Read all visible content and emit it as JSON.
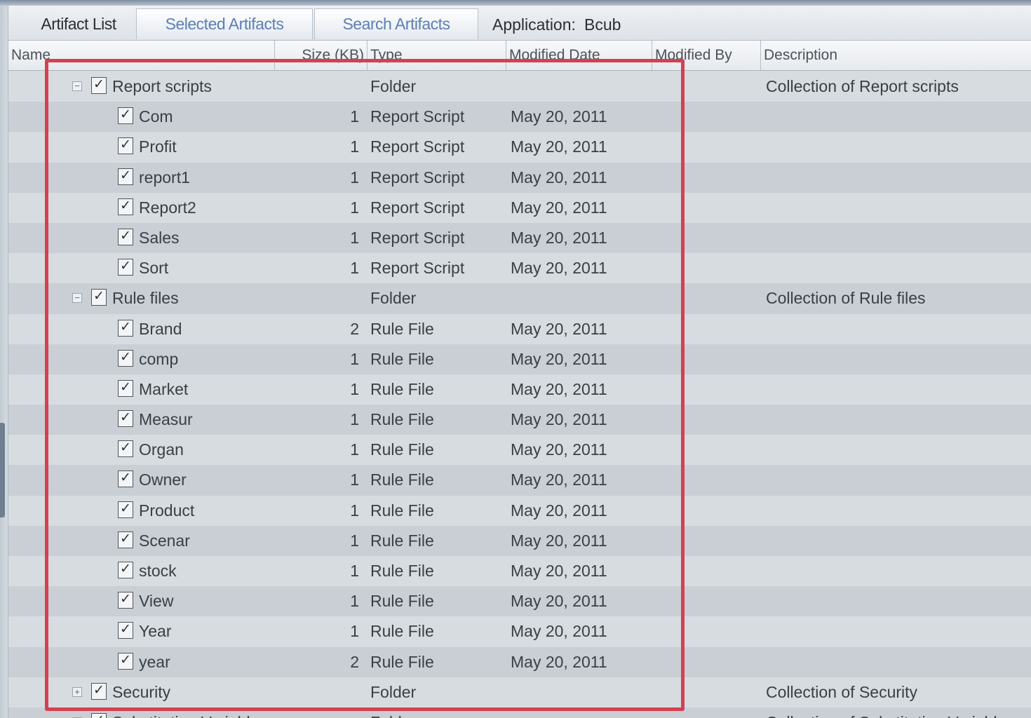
{
  "tabs": {
    "artifact_list": "Artifact List",
    "selected_artifacts": "Selected Artifacts",
    "search_artifacts": "Search Artifacts"
  },
  "application": {
    "label": "Application:",
    "value": "Bcub"
  },
  "columns": {
    "name": "Name",
    "size": "Size (KB)",
    "type": "Type",
    "modified_date": "Modified Date",
    "modified_by": "Modified By",
    "description": "Description"
  },
  "rows": [
    {
      "level": 0,
      "expander": "−",
      "checked": "✓",
      "name": "Report scripts",
      "size": "",
      "type": "Folder",
      "date": "",
      "desc": "Collection of Report scripts"
    },
    {
      "level": 1,
      "checked": "✓",
      "name": "Com",
      "size": "1",
      "type": "Report Script",
      "date": "May 20, 2011",
      "desc": ""
    },
    {
      "level": 1,
      "checked": "✓",
      "name": "Profit",
      "size": "1",
      "type": "Report Script",
      "date": "May 20, 2011",
      "desc": ""
    },
    {
      "level": 1,
      "checked": "✓",
      "name": "report1",
      "size": "1",
      "type": "Report Script",
      "date": "May 20, 2011",
      "desc": ""
    },
    {
      "level": 1,
      "checked": "✓",
      "name": "Report2",
      "size": "1",
      "type": "Report Script",
      "date": "May 20, 2011",
      "desc": ""
    },
    {
      "level": 1,
      "checked": "✓",
      "name": "Sales",
      "size": "1",
      "type": "Report Script",
      "date": "May 20, 2011",
      "desc": ""
    },
    {
      "level": 1,
      "checked": "✓",
      "name": "Sort",
      "size": "1",
      "type": "Report Script",
      "date": "May 20, 2011",
      "desc": ""
    },
    {
      "level": 0,
      "expander": "−",
      "checked": "✓",
      "name": "Rule files",
      "size": "",
      "type": "Folder",
      "date": "",
      "desc": "Collection of Rule files"
    },
    {
      "level": 1,
      "checked": "✓",
      "name": "Brand",
      "size": "2",
      "type": "Rule File",
      "date": "May 20, 2011",
      "desc": ""
    },
    {
      "level": 1,
      "checked": "✓",
      "name": "comp",
      "size": "1",
      "type": "Rule File",
      "date": "May 20, 2011",
      "desc": ""
    },
    {
      "level": 1,
      "checked": "✓",
      "name": "Market",
      "size": "1",
      "type": "Rule File",
      "date": "May 20, 2011",
      "desc": ""
    },
    {
      "level": 1,
      "checked": "✓",
      "name": "Measur",
      "size": "1",
      "type": "Rule File",
      "date": "May 20, 2011",
      "desc": ""
    },
    {
      "level": 1,
      "checked": "✓",
      "name": "Organ",
      "size": "1",
      "type": "Rule File",
      "date": "May 20, 2011",
      "desc": ""
    },
    {
      "level": 1,
      "checked": "✓",
      "name": "Owner",
      "size": "1",
      "type": "Rule File",
      "date": "May 20, 2011",
      "desc": ""
    },
    {
      "level": 1,
      "checked": "✓",
      "name": "Product",
      "size": "1",
      "type": "Rule File",
      "date": "May 20, 2011",
      "desc": ""
    },
    {
      "level": 1,
      "checked": "✓",
      "name": "Scenar",
      "size": "1",
      "type": "Rule File",
      "date": "May 20, 2011",
      "desc": ""
    },
    {
      "level": 1,
      "checked": "✓",
      "name": "stock",
      "size": "1",
      "type": "Rule File",
      "date": "May 20, 2011",
      "desc": ""
    },
    {
      "level": 1,
      "checked": "✓",
      "name": "View",
      "size": "1",
      "type": "Rule File",
      "date": "May 20, 2011",
      "desc": ""
    },
    {
      "level": 1,
      "checked": "✓",
      "name": "Year",
      "size": "1",
      "type": "Rule File",
      "date": "May 20, 2011",
      "desc": ""
    },
    {
      "level": 1,
      "checked": "✓",
      "name": "year",
      "size": "2",
      "type": "Rule File",
      "date": "May 20, 2011",
      "desc": ""
    },
    {
      "level": 0,
      "expander": "+",
      "checked": "✓",
      "name": "Security",
      "size": "",
      "type": "Folder",
      "date": "",
      "desc": "Collection of Security"
    },
    {
      "level": 0,
      "expander": "+",
      "checked": "✓",
      "name": "Substitution Variables",
      "size": "",
      "type": "Folder",
      "date": "",
      "desc": "Collection of Substitution Variables"
    }
  ],
  "colors": {
    "highlight": "#d6404e",
    "link": "#5b7fb3",
    "row_odd": "#d7dce1",
    "row_even": "#c9cfd5"
  }
}
